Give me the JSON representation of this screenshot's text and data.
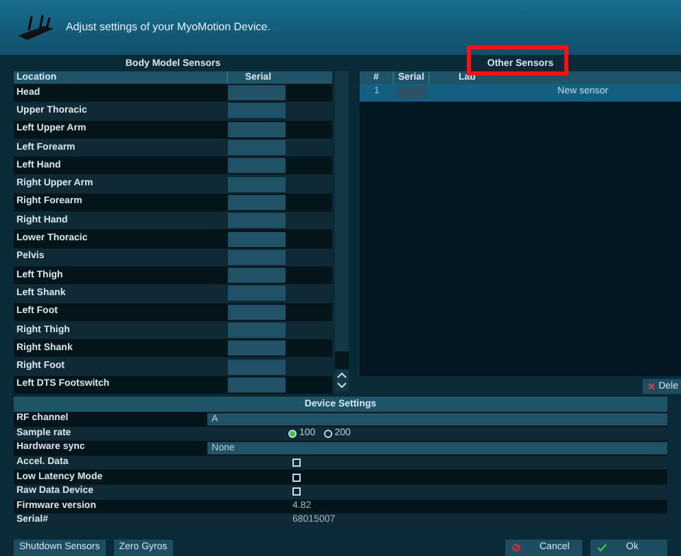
{
  "window": {
    "title": "Adjust settings of your MyoMotion Device."
  },
  "body_model_sensors": {
    "title": "Body Model Sensors",
    "columns": [
      "Location",
      "Serial"
    ],
    "rows": [
      {
        "location": "Head"
      },
      {
        "location": "Upper Thoracic"
      },
      {
        "location": "Left Upper Arm"
      },
      {
        "location": "Left Forearm"
      },
      {
        "location": "Left Hand"
      },
      {
        "location": "Right Upper Arm"
      },
      {
        "location": "Right Forearm"
      },
      {
        "location": "Right Hand"
      },
      {
        "location": "Lower Thoracic"
      },
      {
        "location": "Pelvis"
      },
      {
        "location": "Left Thigh"
      },
      {
        "location": "Left Shank"
      },
      {
        "location": "Left Foot"
      },
      {
        "location": "Right Thigh"
      },
      {
        "location": "Right Shank"
      },
      {
        "location": "Right Foot"
      },
      {
        "location": "Left DTS Footswitch"
      }
    ]
  },
  "other_sensors": {
    "title": "Other Sensors",
    "highlighted": true,
    "columns": [
      "#",
      "Serial",
      "Lab"
    ],
    "rows": [
      {
        "number": "1",
        "label": "New sensor",
        "selected": true
      }
    ],
    "delete_button": "Dele"
  },
  "device_settings": {
    "title": "Device Settings",
    "rows": [
      {
        "kind": "dropdown",
        "label": "RF channel",
        "value": "A"
      },
      {
        "kind": "radio",
        "label": "Sample rate",
        "options": [
          {
            "label": "100",
            "selected": true
          },
          {
            "label": "200",
            "selected": false
          }
        ]
      },
      {
        "kind": "dropdown",
        "label": "Hardware sync",
        "value": "None"
      },
      {
        "kind": "checkbox",
        "label": "Accel. Data",
        "checked": false
      },
      {
        "kind": "checkbox",
        "label": "Low Latency Mode",
        "checked": false
      },
      {
        "kind": "checkbox",
        "label": "Raw Data Device",
        "checked": false
      },
      {
        "kind": "text",
        "label": "Firmware version",
        "value": "4.82"
      },
      {
        "kind": "text",
        "label": "Serial#",
        "value": "68015007"
      }
    ]
  },
  "buttons": [
    {
      "label": "Shutdown Sensors",
      "kind": "plain"
    },
    {
      "label": "Zero Gyros",
      "kind": "plain"
    },
    {
      "label": "Cancel",
      "kind": "cancel"
    },
    {
      "label": "Ok",
      "kind": "ok"
    }
  ]
}
